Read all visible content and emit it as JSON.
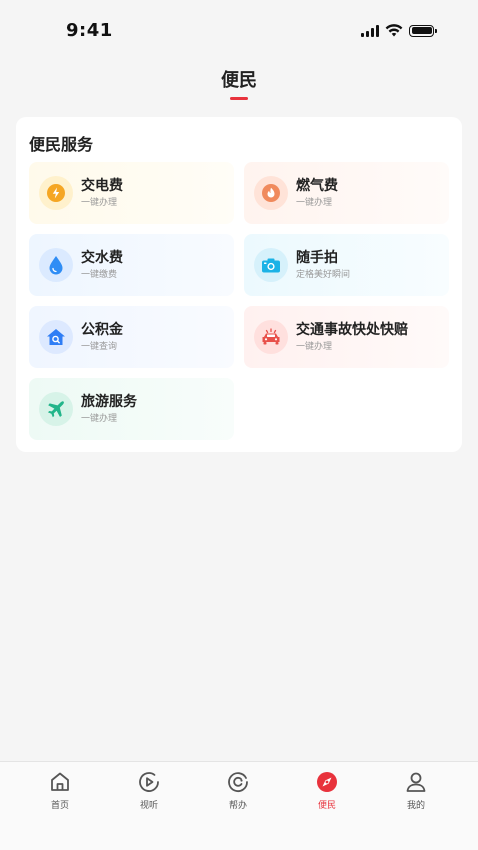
{
  "status_bar": {
    "time": "9:41"
  },
  "nav": {
    "title": "便民"
  },
  "card": {
    "title": "便民服务",
    "services": [
      {
        "name": "交电费",
        "subtitle": "一键办理",
        "icon": "lightning-icon",
        "color": "#f5a623"
      },
      {
        "name": "燃气费",
        "subtitle": "一键办理",
        "icon": "flame-icon",
        "color": "#f08a5d"
      },
      {
        "name": "交水费",
        "subtitle": "一键缴费",
        "icon": "water-drop-icon",
        "color": "#2f8df5"
      },
      {
        "name": "随手拍",
        "subtitle": "定格美好瞬间",
        "icon": "camera-icon",
        "color": "#1ab2e6"
      },
      {
        "name": "公积金",
        "subtitle": "一键查询",
        "icon": "house-search-icon",
        "color": "#2f7df5"
      },
      {
        "name": "交通事故快处快赔",
        "subtitle": "一键办理",
        "icon": "car-accident-icon",
        "color": "#e8504a"
      },
      {
        "name": "旅游服务",
        "subtitle": "一键办理",
        "icon": "airplane-icon",
        "color": "#22b58a"
      }
    ]
  },
  "tab_bar": {
    "active_color": "#e8323c",
    "tabs": [
      {
        "label": "首页",
        "icon": "home-icon"
      },
      {
        "label": "视听",
        "icon": "play-icon"
      },
      {
        "label": "帮办",
        "icon": "smile-icon"
      },
      {
        "label": "便民",
        "icon": "compass-icon",
        "active": true
      },
      {
        "label": "我的",
        "icon": "user-icon"
      }
    ]
  }
}
